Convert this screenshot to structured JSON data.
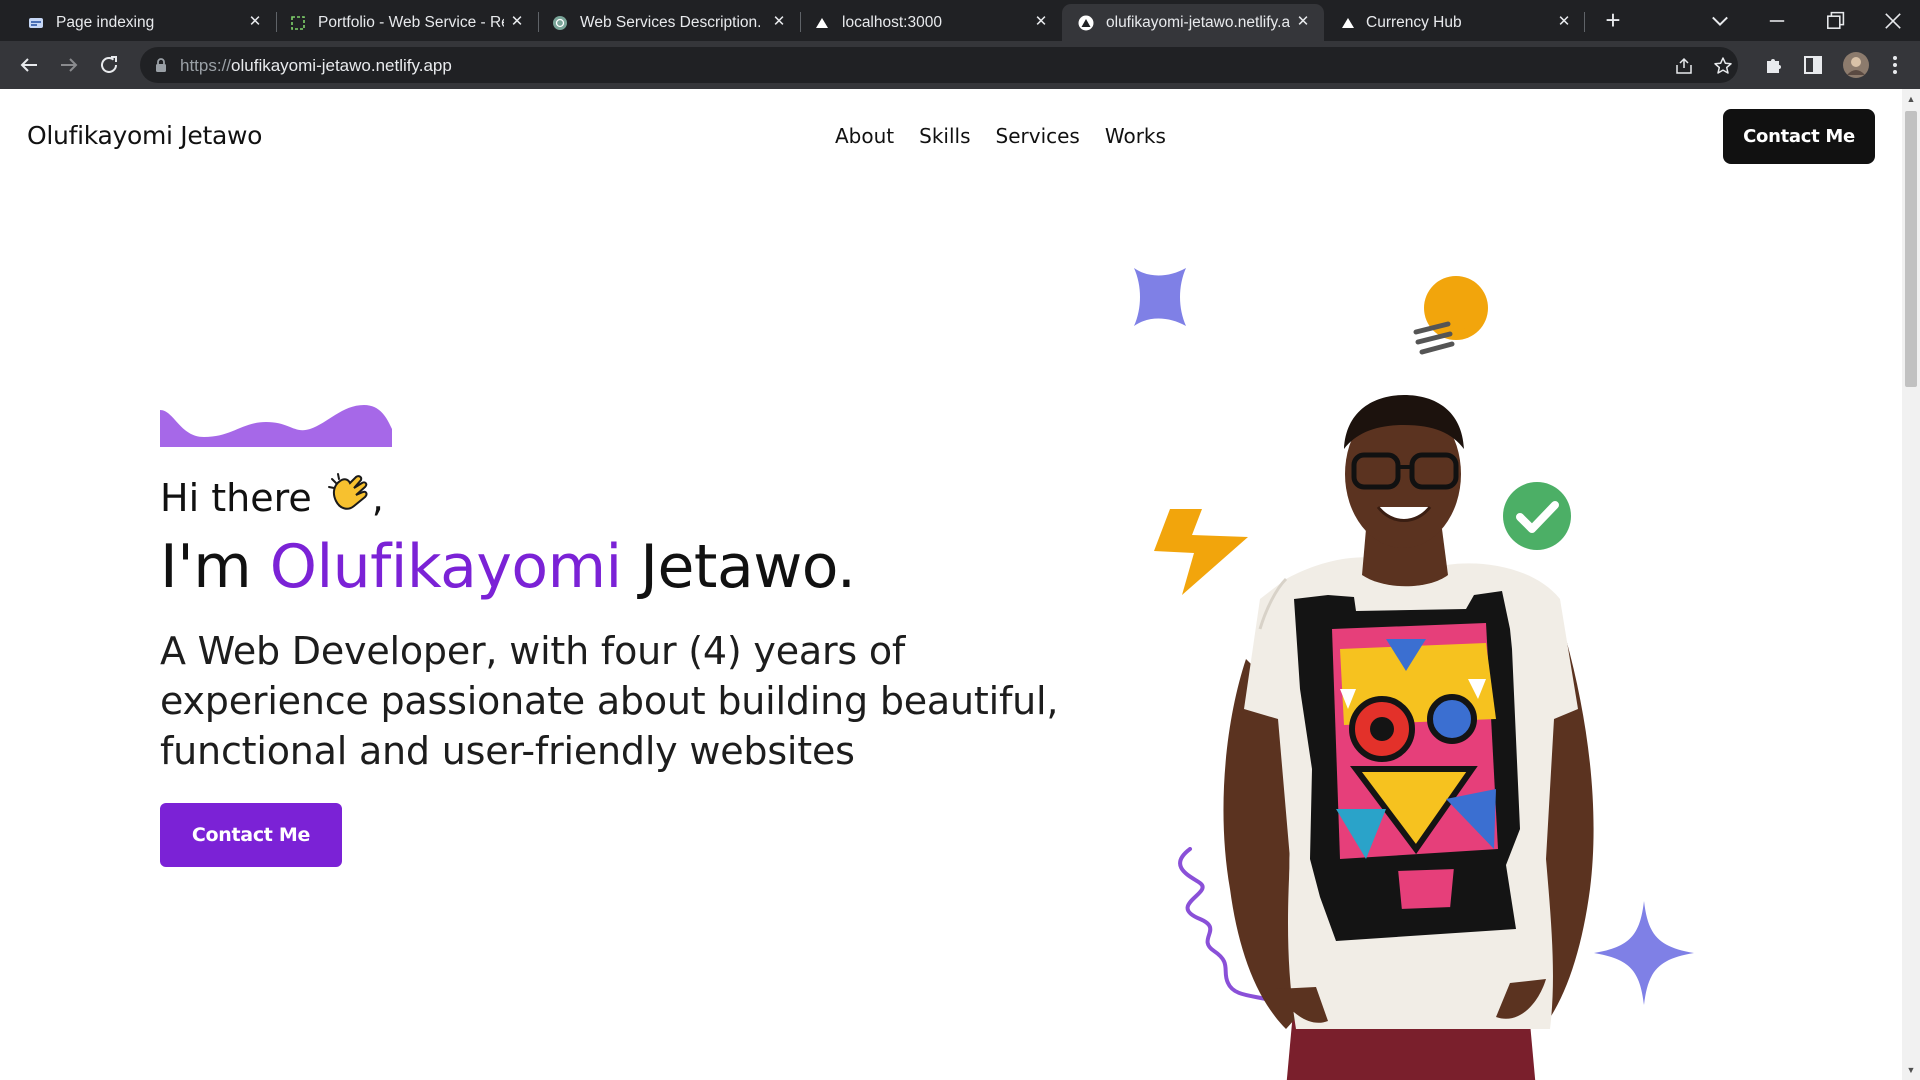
{
  "browser": {
    "tabs": [
      {
        "title": "Page indexing",
        "favicon": "search-console-icon",
        "active": false
      },
      {
        "title": "Portfolio - Web Service - Re",
        "favicon": "replit-icon",
        "active": false
      },
      {
        "title": "Web Services Description.",
        "favicon": "chatgpt-icon",
        "active": false
      },
      {
        "title": "localhost:3000",
        "favicon": "triangle-icon",
        "active": false
      },
      {
        "title": "olufikayomi-jetawo.netlify.a",
        "favicon": "triangle-icon",
        "active": true
      },
      {
        "title": "Currency Hub",
        "favicon": "triangle-icon",
        "active": false
      }
    ],
    "url_scheme": "https://",
    "url_host": "olufikayomi-jetawo.netlify.app"
  },
  "site": {
    "brand": "Olufikayomi Jetawo",
    "nav": [
      "About",
      "Skills",
      "Services",
      "Works"
    ],
    "header_cta": "Contact Me",
    "hero": {
      "greeting": "Hi there",
      "greeting_emoji": "👋",
      "greeting_suffix": ",",
      "headline_prefix": "I'm ",
      "headline_highlight": "Olufikayomi",
      "headline_suffix": " Jetawo.",
      "description": "A Web Developer, with four (4) years of experience passionate about building beautiful, functional and user-friendly websites",
      "cta": "Contact Me"
    }
  },
  "colors": {
    "accent": "#7b22d6",
    "wave": "#a668e8",
    "sparkle": "#7f80e6",
    "bulb": "#f2a50c",
    "check": "#4caf66",
    "squiggle": "#8a50d8"
  }
}
